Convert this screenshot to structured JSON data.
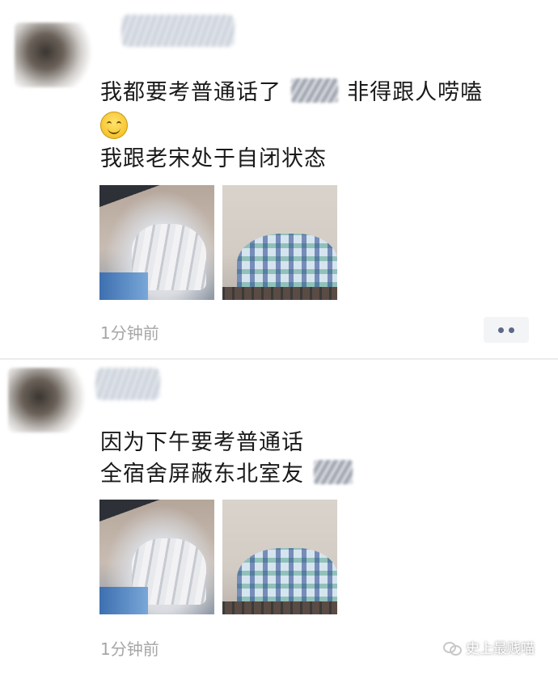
{
  "posts": [
    {
      "text_line1_before": "我都要考普通话了",
      "text_line1_after": "非得跟人唠嗑",
      "text_line2": "我跟老宋处于自闭状态",
      "timestamp": "1分钟前"
    },
    {
      "text_line1": "因为下午要考普通话",
      "text_line2": "全宿舍屏蔽东北室友",
      "timestamp": "1分钟前"
    }
  ],
  "icons": {
    "emoji": "smiling-face-emoji-icon",
    "more": "more-dots-icon",
    "watermark": "wechat-icon"
  },
  "watermark": {
    "text": "史上最贱喵"
  },
  "colors": {
    "timestamp": "#a6a6a6",
    "more_button_bg": "#f3f4f6",
    "more_dots": "#5b6a86"
  }
}
